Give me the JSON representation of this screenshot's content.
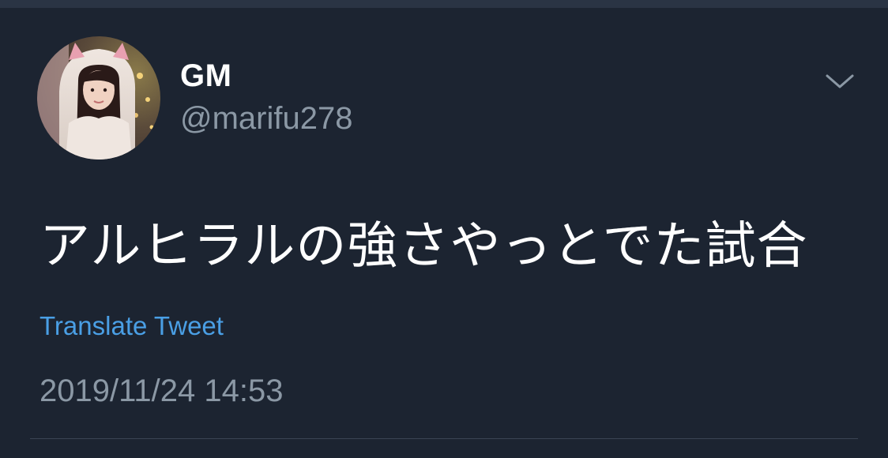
{
  "tweet": {
    "display_name": "GM",
    "handle": "@marifu278",
    "text": "アルヒラルの強さやっとでた試合",
    "translate_label": "Translate Tweet",
    "timestamp": "2019/11/24 14:53"
  },
  "icons": {
    "menu": "chevron-down-icon",
    "avatar": "profile-photo"
  },
  "colors": {
    "background": "#1c2431",
    "primary_text": "#ffffff",
    "secondary_text": "#8b98a5",
    "link": "#4a9fe5",
    "divider": "#3a4454"
  }
}
